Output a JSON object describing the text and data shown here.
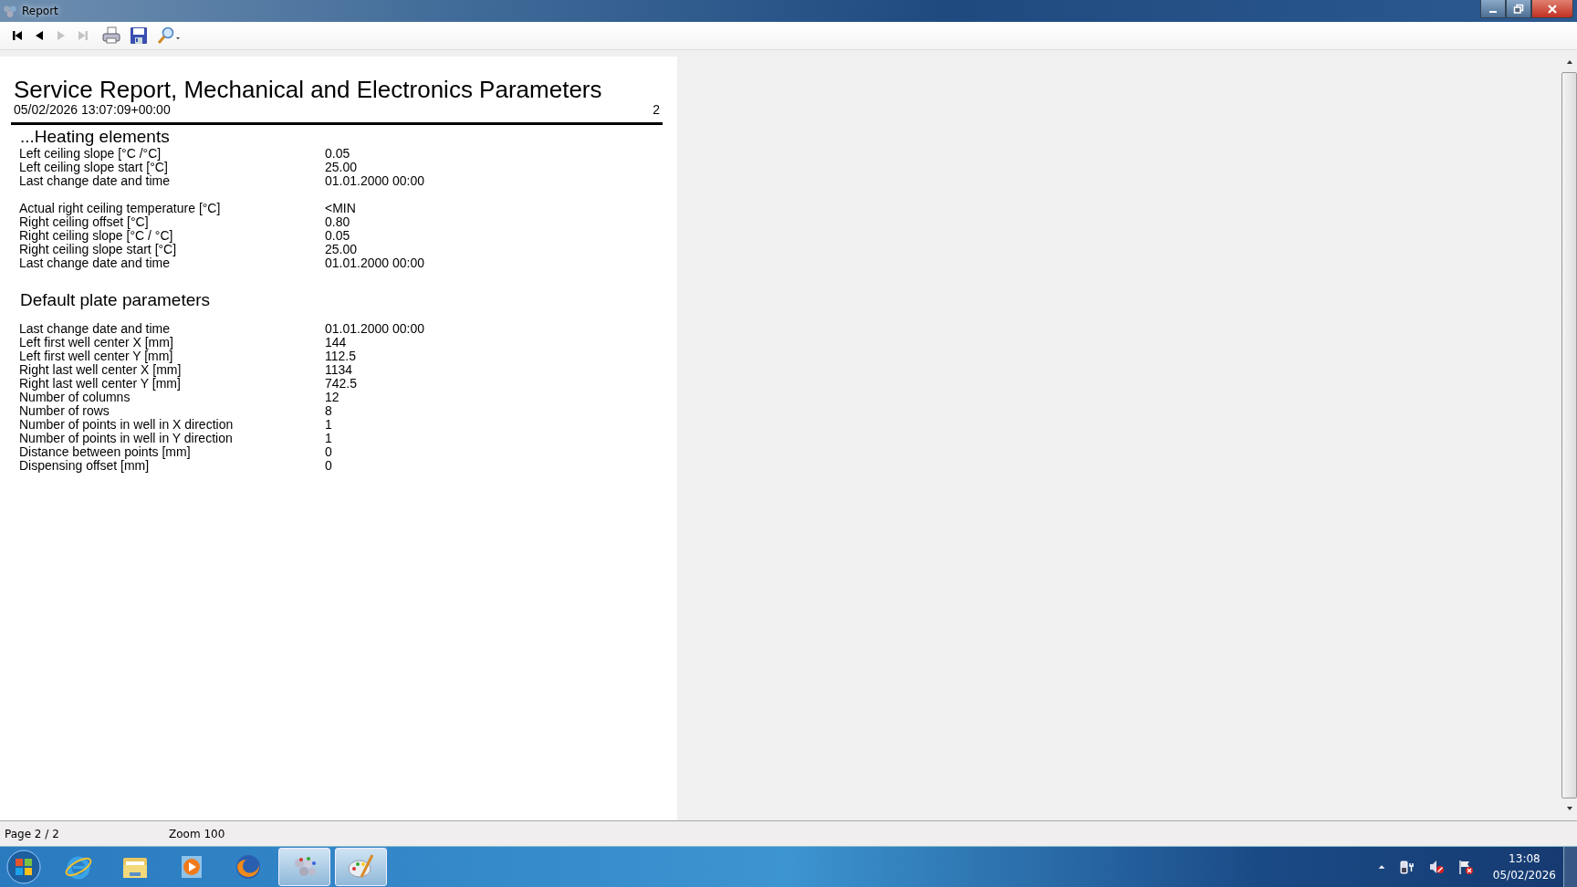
{
  "window": {
    "title": "Report"
  },
  "toolbar": [
    {
      "kind": "first",
      "disabled": false
    },
    {
      "kind": "prev",
      "disabled": false
    },
    {
      "kind": "next",
      "disabled": true
    },
    {
      "kind": "last",
      "disabled": true
    },
    {
      "kind": "print",
      "disabled": false
    },
    {
      "kind": "save",
      "disabled": false
    },
    {
      "kind": "zoom",
      "disabled": false
    }
  ],
  "report": {
    "title": "Service Report, Mechanical and Electronics Parameters",
    "timestamp": "05/02/2026 13:07:09+00:00",
    "page_number": "2",
    "sections": [
      {
        "heading": "...Heating elements",
        "groups": [
          [
            {
              "label": "Left ceiling slope [°C /°C]",
              "value": "0.05"
            },
            {
              "label": "Left ceiling slope start [°C]",
              "value": "25.00"
            },
            {
              "label": "Last change date and time",
              "value": "01.01.2000 00:00"
            }
          ],
          [
            {
              "label": "Actual right ceiling temperature [°C]",
              "value": "<MIN"
            },
            {
              "label": "Right ceiling offset [°C]",
              "value": "0.80"
            },
            {
              "label": "Right ceiling slope [°C / °C]",
              "value": "0.05"
            },
            {
              "label": "Right ceiling slope start [°C]",
              "value": "25.00"
            },
            {
              "label": "Last change date and time",
              "value": "01.01.2000 00:00"
            }
          ]
        ]
      },
      {
        "heading": "Default plate parameters",
        "groups": [
          [
            {
              "label": "Last change date and time",
              "value": "01.01.2000 00:00"
            },
            {
              "label": "Left first well center X [mm]",
              "value": "144"
            },
            {
              "label": "Left first well center Y [mm]",
              "value": "112.5"
            },
            {
              "label": "Right last well center X [mm]",
              "value": "1134"
            },
            {
              "label": "Right last well center Y [mm]",
              "value": "742.5"
            },
            {
              "label": "Number of columns",
              "value": "12"
            },
            {
              "label": "Number of rows",
              "value": "8"
            },
            {
              "label": "Number of points in well in X direction",
              "value": "1"
            },
            {
              "label": "Number of points in well in Y direction",
              "value": "1"
            },
            {
              "label": "Distance between points [mm]",
              "value": "0"
            },
            {
              "label": "Dispensing offset [mm]",
              "value": "0"
            }
          ]
        ]
      }
    ]
  },
  "status_bar": {
    "page": "Page 2 / 2",
    "zoom": "Zoom 100"
  },
  "taskbar": {
    "apps": [
      {
        "kind": "browser-e",
        "running": false
      },
      {
        "kind": "folder",
        "running": false
      },
      {
        "kind": "media",
        "running": false
      },
      {
        "kind": "firefox",
        "running": false
      },
      {
        "kind": "molecule",
        "running": true
      },
      {
        "kind": "paint",
        "running": true
      }
    ],
    "clock": {
      "time": "13:08",
      "date": "05/02/2026"
    }
  }
}
